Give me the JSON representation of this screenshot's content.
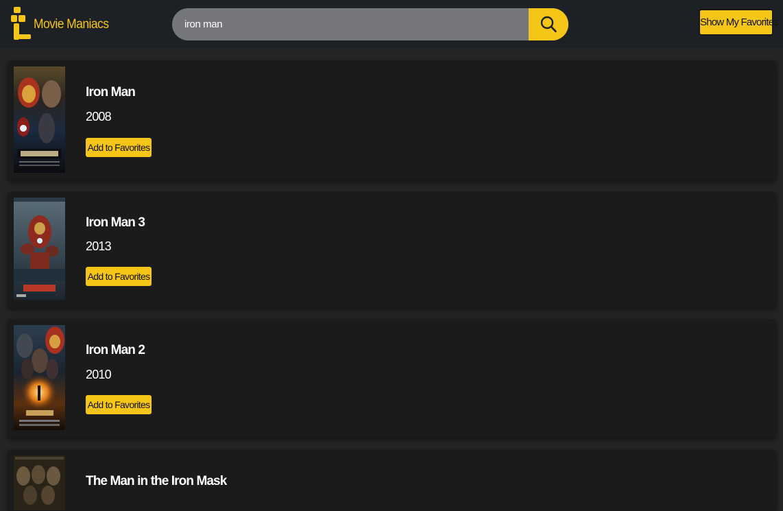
{
  "app": {
    "brand": "Movie Maniacs",
    "accent_color": "#f5c518"
  },
  "search": {
    "value": "iron man",
    "button_icon": "search-icon"
  },
  "header": {
    "favorites_label": "Show My Favorites"
  },
  "movies": [
    {
      "title": "Iron Man",
      "year": "2008",
      "add_label": "Add to Favorites",
      "poster_text": "IRON MAN"
    },
    {
      "title": "Iron Man 3",
      "year": "2013",
      "add_label": "Add to Favorites",
      "poster_text": "IRON MAN 3"
    },
    {
      "title": "Iron Man 2",
      "year": "2010",
      "add_label": "Add to Favorites",
      "poster_text": "IRON MAN 2"
    },
    {
      "title": "The Man in the Iron Mask"
    }
  ]
}
